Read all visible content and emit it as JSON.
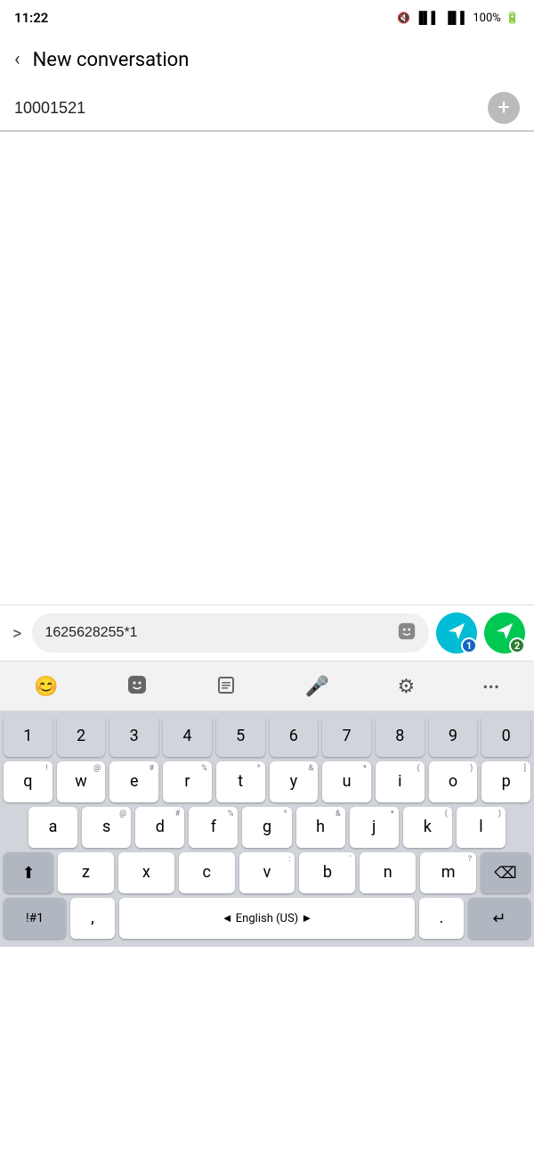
{
  "statusBar": {
    "time": "11:22",
    "battery": "100%",
    "muteIcon": "🔇",
    "signalIcon": "📶"
  },
  "header": {
    "backIcon": "‹",
    "title": "New conversation"
  },
  "recipientField": {
    "value": "10001521",
    "addIcon": "+"
  },
  "inputBar": {
    "expandIcon": ">",
    "messageValue": "1625628255*1",
    "stickerIcon": "🎭",
    "sendBtn1Badge": "1",
    "sendBtn2Badge": "2"
  },
  "keyboardToolbar": {
    "icons": [
      "😊",
      "🎭",
      "📋",
      "🎤",
      "⚙",
      "···"
    ]
  },
  "keyboard": {
    "numberRow": [
      "1",
      "2",
      "3",
      "4",
      "5",
      "6",
      "7",
      "8",
      "9",
      "0"
    ],
    "numberSubs": [
      "+",
      "×",
      "÷",
      "=",
      "/",
      "−",
      "<",
      ">",
      "[",
      "]"
    ],
    "row1": [
      "q",
      "w",
      "e",
      "r",
      "t",
      "y",
      "u",
      "i",
      "o",
      "p"
    ],
    "row1Subs": [
      "!",
      "@",
      "#",
      "%",
      "^",
      "&",
      "*",
      "(",
      ")",
      null
    ],
    "row2": [
      "a",
      "s",
      "d",
      "f",
      "g",
      "h",
      "j",
      "k",
      "l"
    ],
    "row2Subs": [
      null,
      "@",
      "#",
      "%",
      "^",
      "&",
      "*",
      "(",
      ")"
    ],
    "row3Middle": [
      "z",
      "x",
      "c",
      "v",
      "b",
      "n",
      "m"
    ],
    "row3Subs": [
      null,
      null,
      null,
      null,
      "'",
      null,
      "?"
    ],
    "specialLeft": "!#1",
    "comma": ",",
    "langLabel": "◄ English (US) ►",
    "period": ".",
    "shiftIcon": "⬆",
    "deleteIcon": "⌫",
    "enterIcon": "↵"
  }
}
